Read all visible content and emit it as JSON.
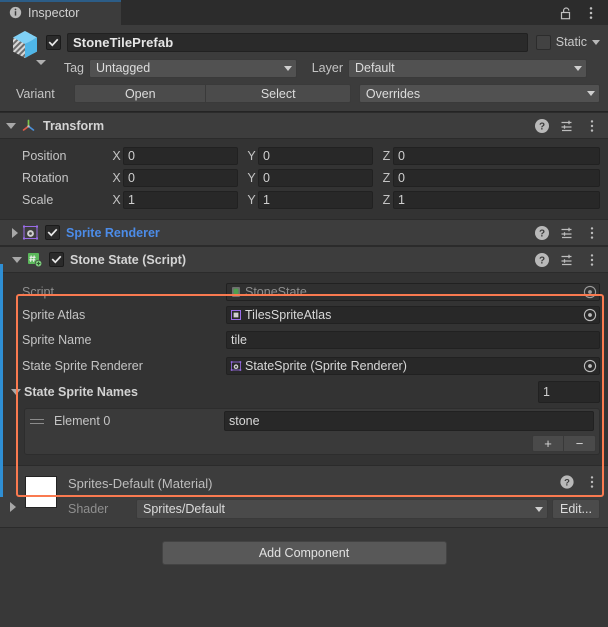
{
  "window": {
    "tab_label": "Inspector",
    "tab_icon": "info-icon",
    "lock_icon": "padlock-unlocked-icon",
    "menu_icon": "kebab-menu-icon"
  },
  "object_header": {
    "prefab_icon": "prefab-variant-cube-icon",
    "enabled_checkbox": true,
    "name": "StoneTilePrefab",
    "static_label": "Static",
    "static_checked": false,
    "tag_label": "Tag",
    "tag_value": "Untagged",
    "layer_label": "Layer",
    "layer_value": "Default",
    "variant_label": "Variant",
    "open_button": "Open",
    "select_button": "Select",
    "overrides_dropdown": "Overrides"
  },
  "transform": {
    "icon": "transform-axis-icon",
    "title": "Transform",
    "expanded": true,
    "rows": [
      {
        "label": "Position",
        "x": "0",
        "y": "0",
        "z": "0"
      },
      {
        "label": "Rotation",
        "x": "0",
        "y": "0",
        "z": "0"
      },
      {
        "label": "Scale",
        "x": "1",
        "y": "1",
        "z": "1"
      }
    ],
    "axis_labels": [
      "X",
      "Y",
      "Z"
    ]
  },
  "sprite_renderer": {
    "icon": "sprite-renderer-icon",
    "title": "Sprite Renderer",
    "enabled": true,
    "expanded": false
  },
  "stone_state": {
    "icon": "csharp-script-icon",
    "title": "Stone State (Script)",
    "enabled": true,
    "expanded": true,
    "highlight_color": "#fa7a50",
    "fields": {
      "script_label": "Script",
      "script_value": "StoneState",
      "script_icon": "script-asset-icon",
      "sprite_atlas_label": "Sprite Atlas",
      "sprite_atlas_value": "TilesSpriteAtlas",
      "sprite_atlas_icon": "sprite-atlas-asset-icon",
      "sprite_name_label": "Sprite Name",
      "sprite_name_value": "tile",
      "state_sprite_renderer_label": "State Sprite Renderer",
      "state_sprite_renderer_value": "StateSprite (Sprite Renderer)",
      "state_sprite_renderer_icon": "sprite-renderer-icon",
      "array_label": "State Sprite Names",
      "array_size": "1",
      "array_expanded": true,
      "elements": [
        {
          "label": "Element 0",
          "value": "stone"
        }
      ],
      "add_button": "+",
      "remove_button": "−"
    }
  },
  "material": {
    "title": "Sprites-Default (Material)",
    "swatch_color": "#ffffff",
    "shader_label": "Shader",
    "shader_value": "Sprites/Default",
    "edit_button": "Edit...",
    "expanded": false
  },
  "footer": {
    "add_component": "Add Component"
  },
  "component_header_icons": {
    "help": "help-circle-icon",
    "preset": "preset-sliders-icon",
    "menu": "kebab-menu-icon"
  }
}
